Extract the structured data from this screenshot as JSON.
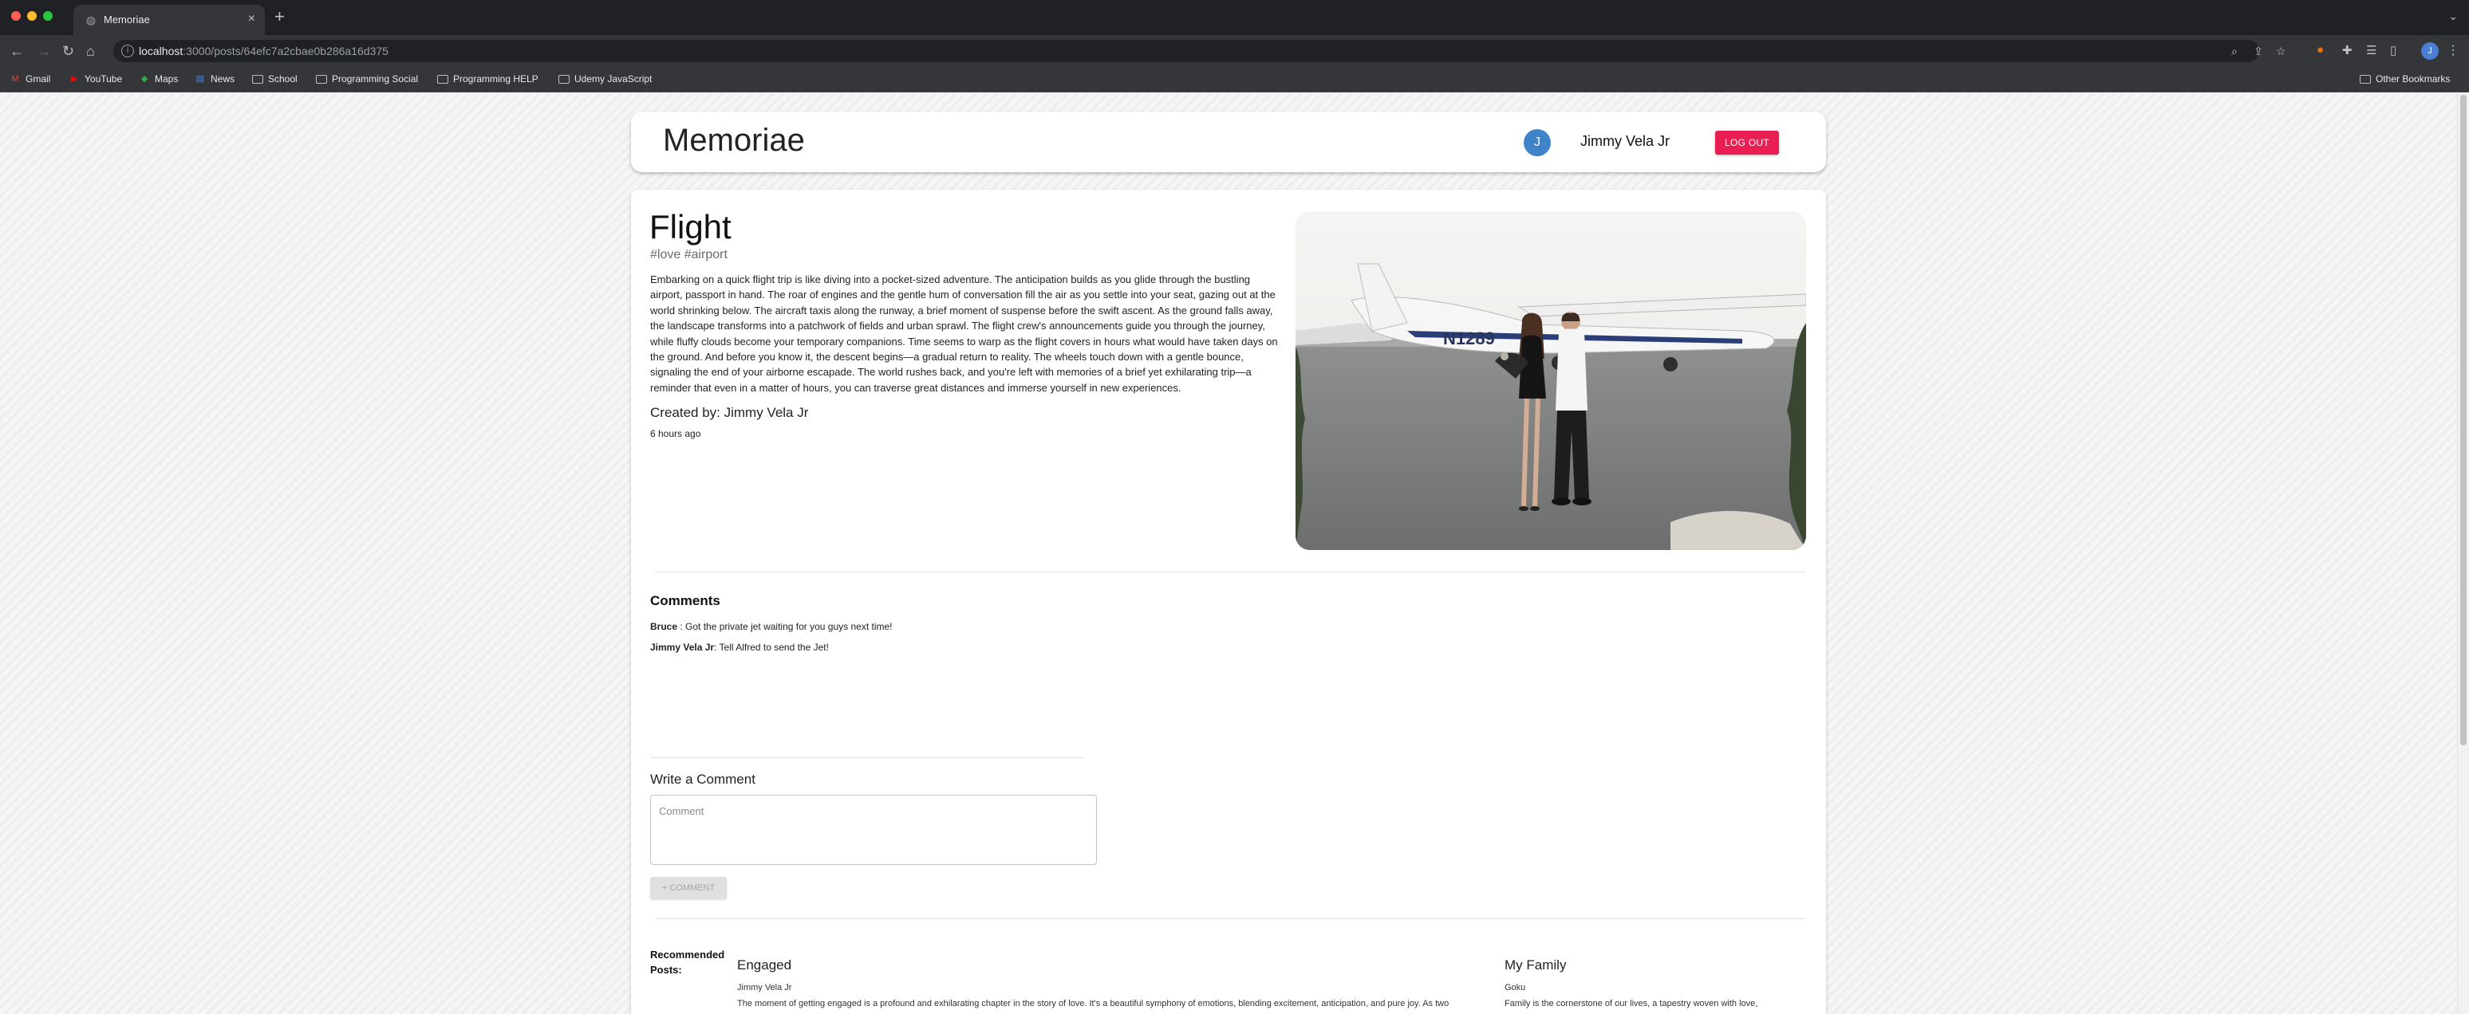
{
  "browser": {
    "tab_title": "Memoriae",
    "url_host": "localhost",
    "url_path": ":3000/posts/64efc7a2cbae0b286a16d375",
    "profile_initial": "J",
    "bookmarks": [
      {
        "label": "Gmail",
        "icon": "gmail-icon"
      },
      {
        "label": "YouTube",
        "icon": "youtube-icon"
      },
      {
        "label": "Maps",
        "icon": "maps-icon"
      },
      {
        "label": "News",
        "icon": "news-icon"
      },
      {
        "label": "School",
        "icon": "folder-icon"
      },
      {
        "label": "Programming Social",
        "icon": "folder-icon"
      },
      {
        "label": "Programming HELP",
        "icon": "folder-icon"
      },
      {
        "label": "Udemy JavaScript",
        "icon": "folder-icon"
      }
    ],
    "other_bookmarks": "Other Bookmarks"
  },
  "appbar": {
    "brand": "Memoriae",
    "avatar_initial": "J",
    "username": "Jimmy Vela Jr",
    "logout_label": "LOG OUT"
  },
  "post": {
    "title": "Flight",
    "tags": "#love #airport",
    "message": "Embarking on a quick flight trip is like diving into a pocket-sized adventure. The anticipation builds as you glide through the bustling airport, passport in hand. The roar of engines and the gentle hum of conversation fill the air as you settle into your seat, gazing out at the world shrinking below. The aircraft taxis along the runway, a brief moment of suspense before the swift ascent. As the ground falls away, the landscape transforms into a patchwork of fields and urban sprawl. The flight crew's announcements guide you through the journey, while fluffy clouds become your temporary companions. Time seems to warp as the flight covers in hours what would have taken days on the ground. And before you know it, the descent begins—a gradual return to reality. The wheels touch down with a gentle bounce, signaling the end of your airborne escapade. The world rushes back, and you're left with memories of a brief yet exhilarating trip—a reminder that even in a matter of hours, you can traverse great distances and immerse yourself in new experiences.",
    "created_by": "Created by: Jimmy Vela Jr",
    "time_ago": "6 hours ago",
    "image_registration": "N1289"
  },
  "comments": {
    "heading": "Comments",
    "items": [
      {
        "author": "Bruce",
        "separator": " : ",
        "text": "Got the private jet waiting for you guys next time!"
      },
      {
        "author": "Jimmy Vela Jr",
        "separator": ": ",
        "text": "Tell Alfred to send the Jet!"
      }
    ]
  },
  "write_comment": {
    "heading": "Write a Comment",
    "placeholder": "Comment",
    "value": "",
    "button_label": "+ COMMENT"
  },
  "recommended": {
    "label": "Recommended Posts:",
    "posts": [
      {
        "title": "Engaged",
        "author": "Jimmy Vela Jr",
        "excerpt": "The moment of getting engaged is a profound and exhilarating chapter in the story of love. It's a beautiful symphony of emotions, blending excitement, anticipation, and pure joy. As two"
      },
      {
        "title": "My Family",
        "author": "Goku",
        "excerpt": "Family is the cornerstone of our lives, a tapestry woven with love,"
      }
    ]
  },
  "colors": {
    "logout": "#e91e52",
    "avatar": "#3f83c9",
    "chrome_dark": "#202124",
    "chrome_toolbar": "#35363a"
  }
}
